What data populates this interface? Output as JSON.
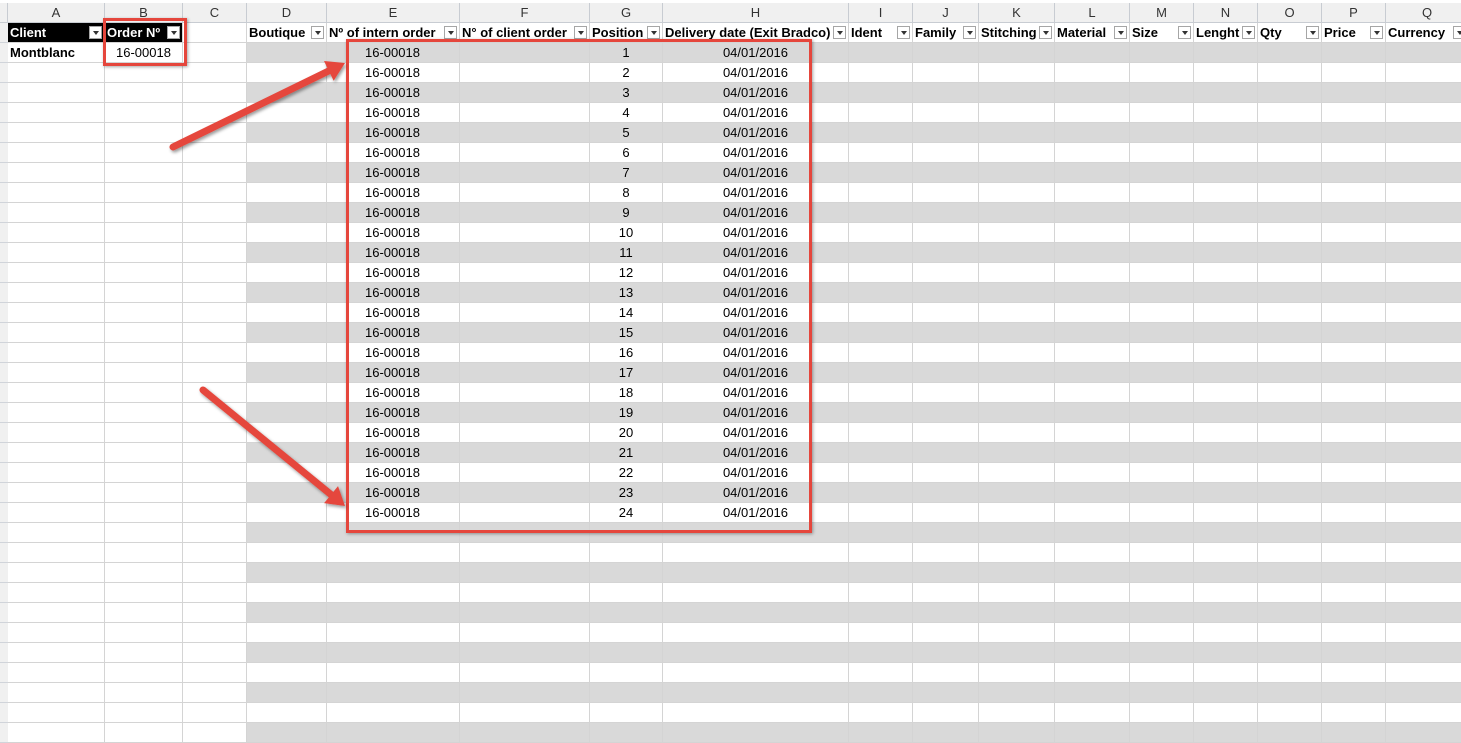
{
  "columns": [
    {
      "letter": "A",
      "width": 97
    },
    {
      "letter": "B",
      "width": 78
    },
    {
      "letter": "C",
      "width": 64
    },
    {
      "letter": "D",
      "width": 80
    },
    {
      "letter": "E",
      "width": 133
    },
    {
      "letter": "F",
      "width": 130
    },
    {
      "letter": "G",
      "width": 73
    },
    {
      "letter": "H",
      "width": 186
    },
    {
      "letter": "I",
      "width": 64
    },
    {
      "letter": "J",
      "width": 66
    },
    {
      "letter": "K",
      "width": 76
    },
    {
      "letter": "L",
      "width": 75
    },
    {
      "letter": "M",
      "width": 64
    },
    {
      "letter": "N",
      "width": 64
    },
    {
      "letter": "O",
      "width": 64
    },
    {
      "letter": "P",
      "width": 64
    },
    {
      "letter": "Q",
      "width": 83
    }
  ],
  "order_table": {
    "headers": [
      "Client",
      "Order Nº"
    ],
    "row": [
      "Montblanc",
      "16-00018"
    ]
  },
  "main_table": {
    "headers": [
      "Boutique",
      "Nº of intern order",
      "N° of client order",
      "Position",
      "Delivery date (Exit Bradco)",
      "Ident",
      "Family",
      "Stitching",
      "Material",
      "Size",
      "Lenght",
      "Qty",
      "Price",
      "Currency"
    ],
    "rows": [
      {
        "intern": "16-00018",
        "position": "1",
        "date": "04/01/2016"
      },
      {
        "intern": "16-00018",
        "position": "2",
        "date": "04/01/2016"
      },
      {
        "intern": "16-00018",
        "position": "3",
        "date": "04/01/2016"
      },
      {
        "intern": "16-00018",
        "position": "4",
        "date": "04/01/2016"
      },
      {
        "intern": "16-00018",
        "position": "5",
        "date": "04/01/2016"
      },
      {
        "intern": "16-00018",
        "position": "6",
        "date": "04/01/2016"
      },
      {
        "intern": "16-00018",
        "position": "7",
        "date": "04/01/2016"
      },
      {
        "intern": "16-00018",
        "position": "8",
        "date": "04/01/2016"
      },
      {
        "intern": "16-00018",
        "position": "9",
        "date": "04/01/2016"
      },
      {
        "intern": "16-00018",
        "position": "10",
        "date": "04/01/2016"
      },
      {
        "intern": "16-00018",
        "position": "11",
        "date": "04/01/2016"
      },
      {
        "intern": "16-00018",
        "position": "12",
        "date": "04/01/2016"
      },
      {
        "intern": "16-00018",
        "position": "13",
        "date": "04/01/2016"
      },
      {
        "intern": "16-00018",
        "position": "14",
        "date": "04/01/2016"
      },
      {
        "intern": "16-00018",
        "position": "15",
        "date": "04/01/2016"
      },
      {
        "intern": "16-00018",
        "position": "16",
        "date": "04/01/2016"
      },
      {
        "intern": "16-00018",
        "position": "17",
        "date": "04/01/2016"
      },
      {
        "intern": "16-00018",
        "position": "18",
        "date": "04/01/2016"
      },
      {
        "intern": "16-00018",
        "position": "19",
        "date": "04/01/2016"
      },
      {
        "intern": "16-00018",
        "position": "20",
        "date": "04/01/2016"
      },
      {
        "intern": "16-00018",
        "position": "21",
        "date": "04/01/2016"
      },
      {
        "intern": "16-00018",
        "position": "22",
        "date": "04/01/2016"
      },
      {
        "intern": "16-00018",
        "position": "23",
        "date": "04/01/2016"
      },
      {
        "intern": "16-00018",
        "position": "24",
        "date": "04/01/2016"
      }
    ],
    "empty_rows": 11
  },
  "colors": {
    "band": "#d9d9d9",
    "highlight": "#e5463c",
    "header_dark": "#000000"
  }
}
